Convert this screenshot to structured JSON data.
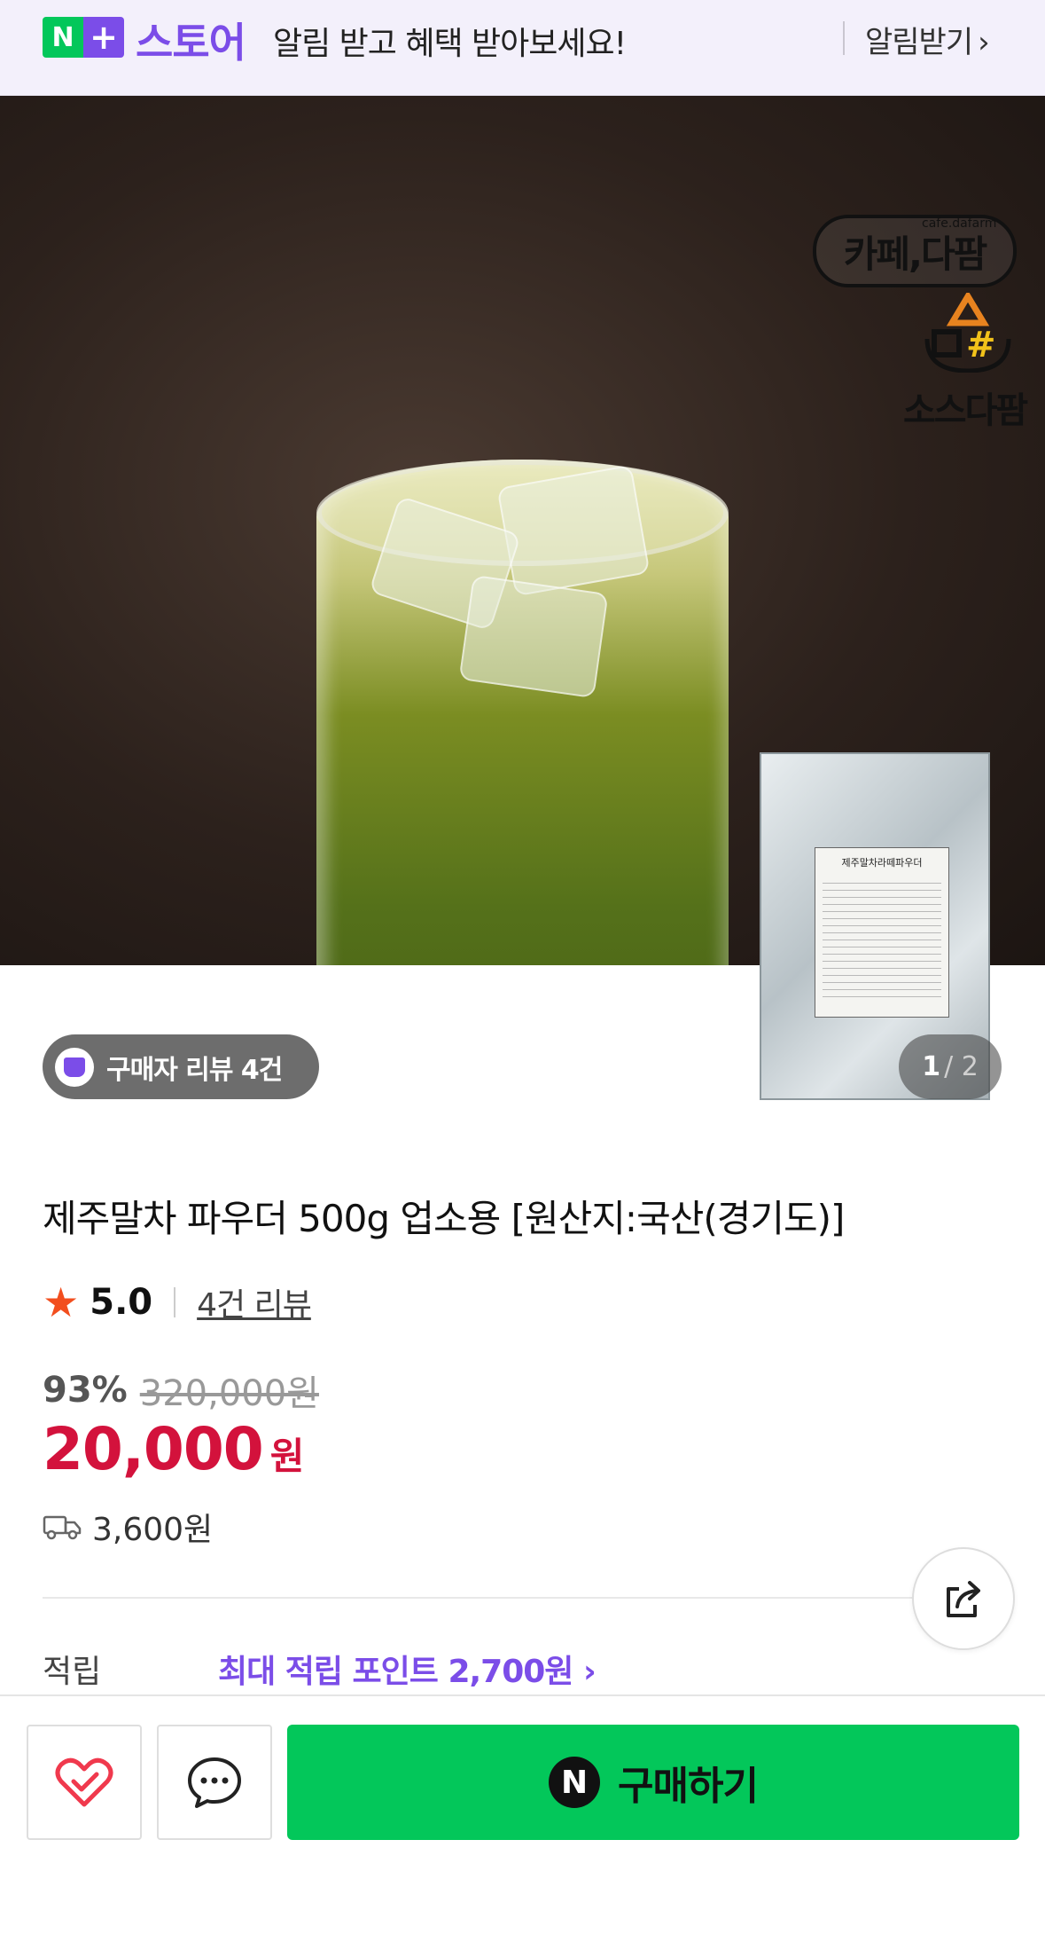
{
  "banner": {
    "logo_n": "N",
    "logo_plus": "+",
    "store_label": "스토어",
    "message": "알림 받고 혜택 받아보세요!",
    "notify_button": "알림받기",
    "chevron": "›"
  },
  "hero": {
    "brand_logo_text": "카페,다팜",
    "brand_logo_sub": "cafe.dafarm",
    "brand2_logo_text": "소스다팜",
    "pack_title": "제주말차라떼파우더",
    "review_pill": "구매자 리뷰 4건",
    "pager_current": "1",
    "pager_total": "/ 2"
  },
  "product": {
    "title": "제주말차 파우더 500g 업소용 [원산지:국산(경기도)]",
    "star_icon": "★",
    "rating": "5.0",
    "reviews_link": "4건 리뷰",
    "discount_pct": "93%",
    "original_price": "320,000원",
    "price": "20,000",
    "price_unit": "원",
    "shipping_fee": "3,600원",
    "points_label": "적립",
    "points_value": "최대 적립 포인트 2,700원 ›"
  },
  "bottom_bar": {
    "buy_logo": "N",
    "buy_label": "구매하기"
  },
  "colors": {
    "accent_purple": "#7b4de8",
    "naver_green": "#03c75a",
    "price_red": "#d3123c",
    "star_orange": "#f24e1e"
  }
}
